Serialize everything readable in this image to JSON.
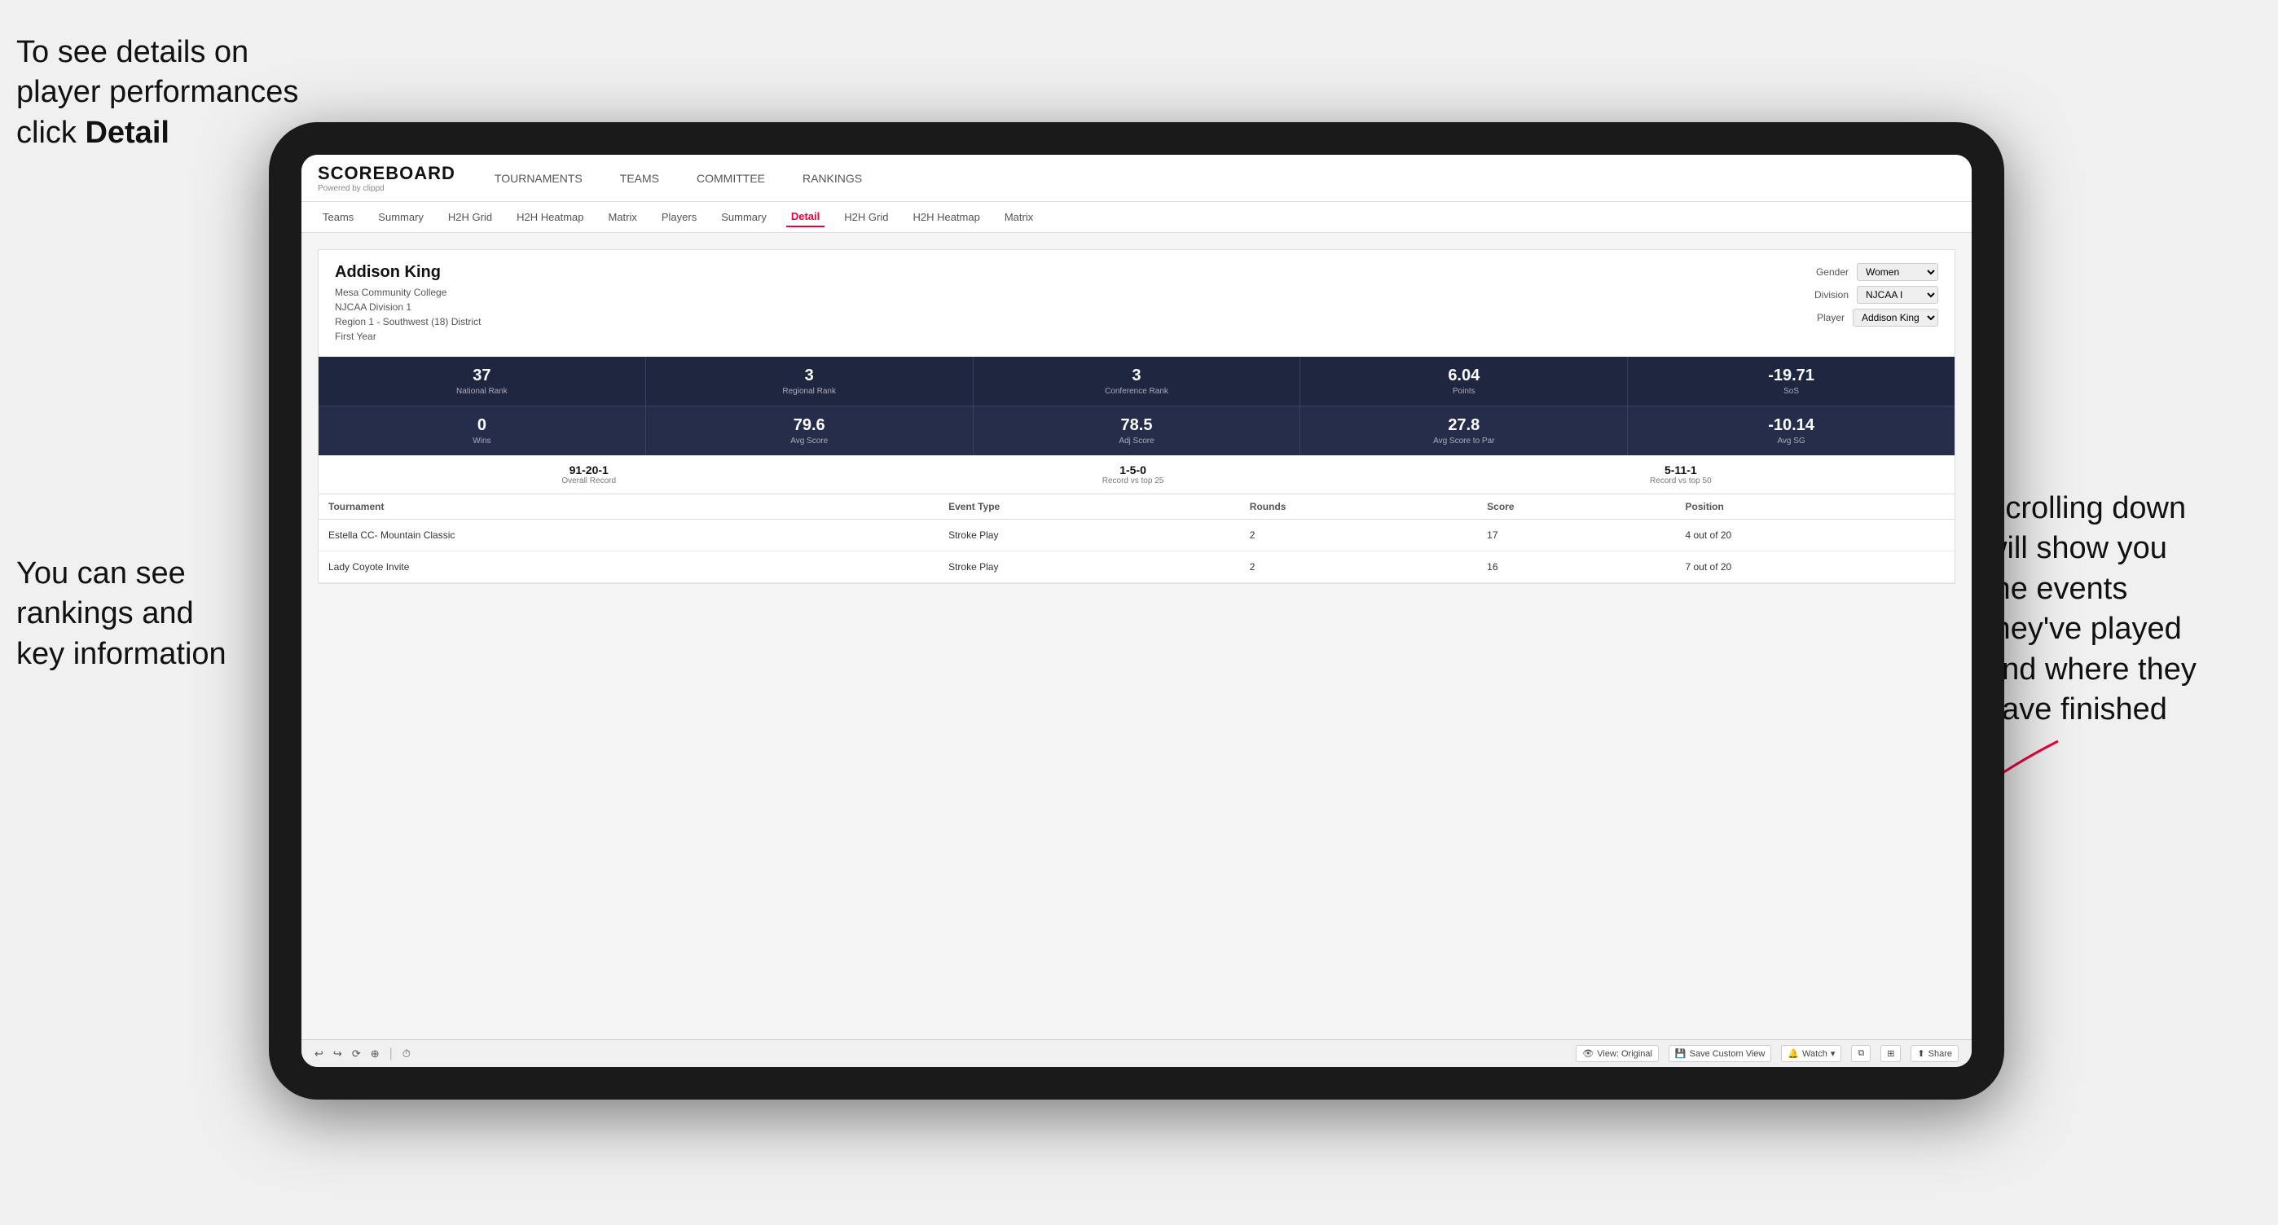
{
  "annotations": {
    "topleft": {
      "line1": "To see details on",
      "line2": "player performances",
      "line3": "click ",
      "line3bold": "Detail"
    },
    "bottomleft": {
      "line1": "You can see",
      "line2": "rankings and",
      "line3": "key information"
    },
    "bottomright": {
      "line1": "Scrolling down",
      "line2": "will show you",
      "line3": "the events",
      "line4": "they've played",
      "line5": "and where they",
      "line6": "have finished"
    }
  },
  "logo": {
    "main": "SCOREBOARD",
    "sub": "Powered by clippd"
  },
  "nav": {
    "items": [
      "TOURNAMENTS",
      "TEAMS",
      "COMMITTEE",
      "RANKINGS"
    ]
  },
  "subnav": {
    "items": [
      "Teams",
      "Summary",
      "H2H Grid",
      "H2H Heatmap",
      "Matrix",
      "Players",
      "Summary",
      "Detail",
      "H2H Grid",
      "H2H Heatmap",
      "Matrix"
    ],
    "active": "Detail"
  },
  "player": {
    "name": "Addison King",
    "college": "Mesa Community College",
    "division": "NJCAA Division 1",
    "region": "Region 1 - Southwest (18) District",
    "year": "First Year"
  },
  "filters": {
    "gender_label": "Gender",
    "gender_value": "Women",
    "division_label": "Division",
    "division_value": "NJCAA I",
    "player_label": "Player",
    "player_value": "Addison King"
  },
  "stats_row1": [
    {
      "value": "37",
      "label": "National Rank"
    },
    {
      "value": "3",
      "label": "Regional Rank"
    },
    {
      "value": "3",
      "label": "Conference Rank"
    },
    {
      "value": "6.04",
      "label": "Points"
    },
    {
      "value": "-19.71",
      "label": "SoS"
    }
  ],
  "stats_row2": [
    {
      "value": "0",
      "label": "Wins"
    },
    {
      "value": "79.6",
      "label": "Avg Score"
    },
    {
      "value": "78.5",
      "label": "Adj Score"
    },
    {
      "value": "27.8",
      "label": "Avg Score to Par"
    },
    {
      "value": "-10.14",
      "label": "Avg SG"
    }
  ],
  "records": [
    {
      "value": "91-20-1",
      "label": "Overall Record"
    },
    {
      "value": "1-5-0",
      "label": "Record vs top 25"
    },
    {
      "value": "5-11-1",
      "label": "Record vs top 50"
    }
  ],
  "table": {
    "headers": [
      "Tournament",
      "Event Type",
      "Rounds",
      "Score",
      "Position"
    ],
    "rows": [
      {
        "tournament": "Estella CC- Mountain Classic",
        "event_type": "Stroke Play",
        "rounds": "2",
        "score": "17",
        "position": "4 out of 20"
      },
      {
        "tournament": "Lady Coyote Invite",
        "event_type": "Stroke Play",
        "rounds": "2",
        "score": "16",
        "position": "7 out of 20"
      }
    ]
  },
  "toolbar": {
    "view_original": "View: Original",
    "save_custom": "Save Custom View",
    "watch": "Watch",
    "share": "Share",
    "undo": "↩",
    "redo": "↪"
  }
}
